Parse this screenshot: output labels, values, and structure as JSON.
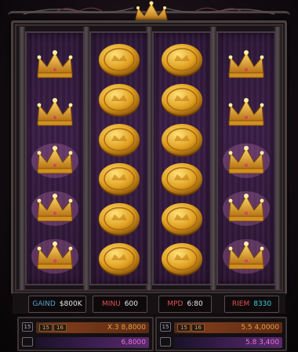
{
  "reels": [
    {
      "symbols": [
        "crown",
        "crown",
        "crown-glow",
        "crown-glow",
        "crown-glow"
      ]
    },
    {
      "symbols": [
        "coin",
        "coin",
        "coin",
        "coin",
        "coin",
        "coin"
      ]
    },
    {
      "symbols": [
        "coin",
        "coin",
        "coin",
        "coin",
        "coin",
        "coin"
      ]
    },
    {
      "symbols": [
        "crown",
        "crown",
        "crown-glow",
        "crown-glow",
        "crown-glow"
      ]
    }
  ],
  "stats": [
    {
      "key": "GAIND",
      "value": "$800K",
      "key_color": "#5aa0c8",
      "value_color": "#e8e8e8"
    },
    {
      "key": "MINU",
      "value": "600",
      "key_color": "#e05050",
      "value_color": "#e8e8e8"
    },
    {
      "key": "MPD",
      "value": "6:80",
      "key_color": "#e05050",
      "value_color": "#e8e8e8"
    },
    {
      "key": "RIEM",
      "value": "8330",
      "key_color": "#e05050",
      "value_color": "#40d0d8"
    }
  ],
  "bet_panels": {
    "left": {
      "icon_top": "15",
      "icon_bottom": "",
      "chips": [
        "15",
        "16"
      ],
      "top_value": "X.3 8,8000",
      "bottom_value": "6,8000"
    },
    "right": {
      "icon_top": "15",
      "icon_bottom": "",
      "chips": [
        "15",
        "16"
      ],
      "top_value": "5.5 4,0000",
      "bottom_value": "5.8 3,400"
    }
  },
  "colors": {
    "gold": "#e0a830",
    "reel_purple": "#3a1e46",
    "accent_red": "#e05050",
    "accent_cyan": "#40d0d8"
  },
  "icons": {
    "top_crown": "crown-icon",
    "coin": "gold-coin-icon",
    "crown": "gold-crown-icon"
  }
}
